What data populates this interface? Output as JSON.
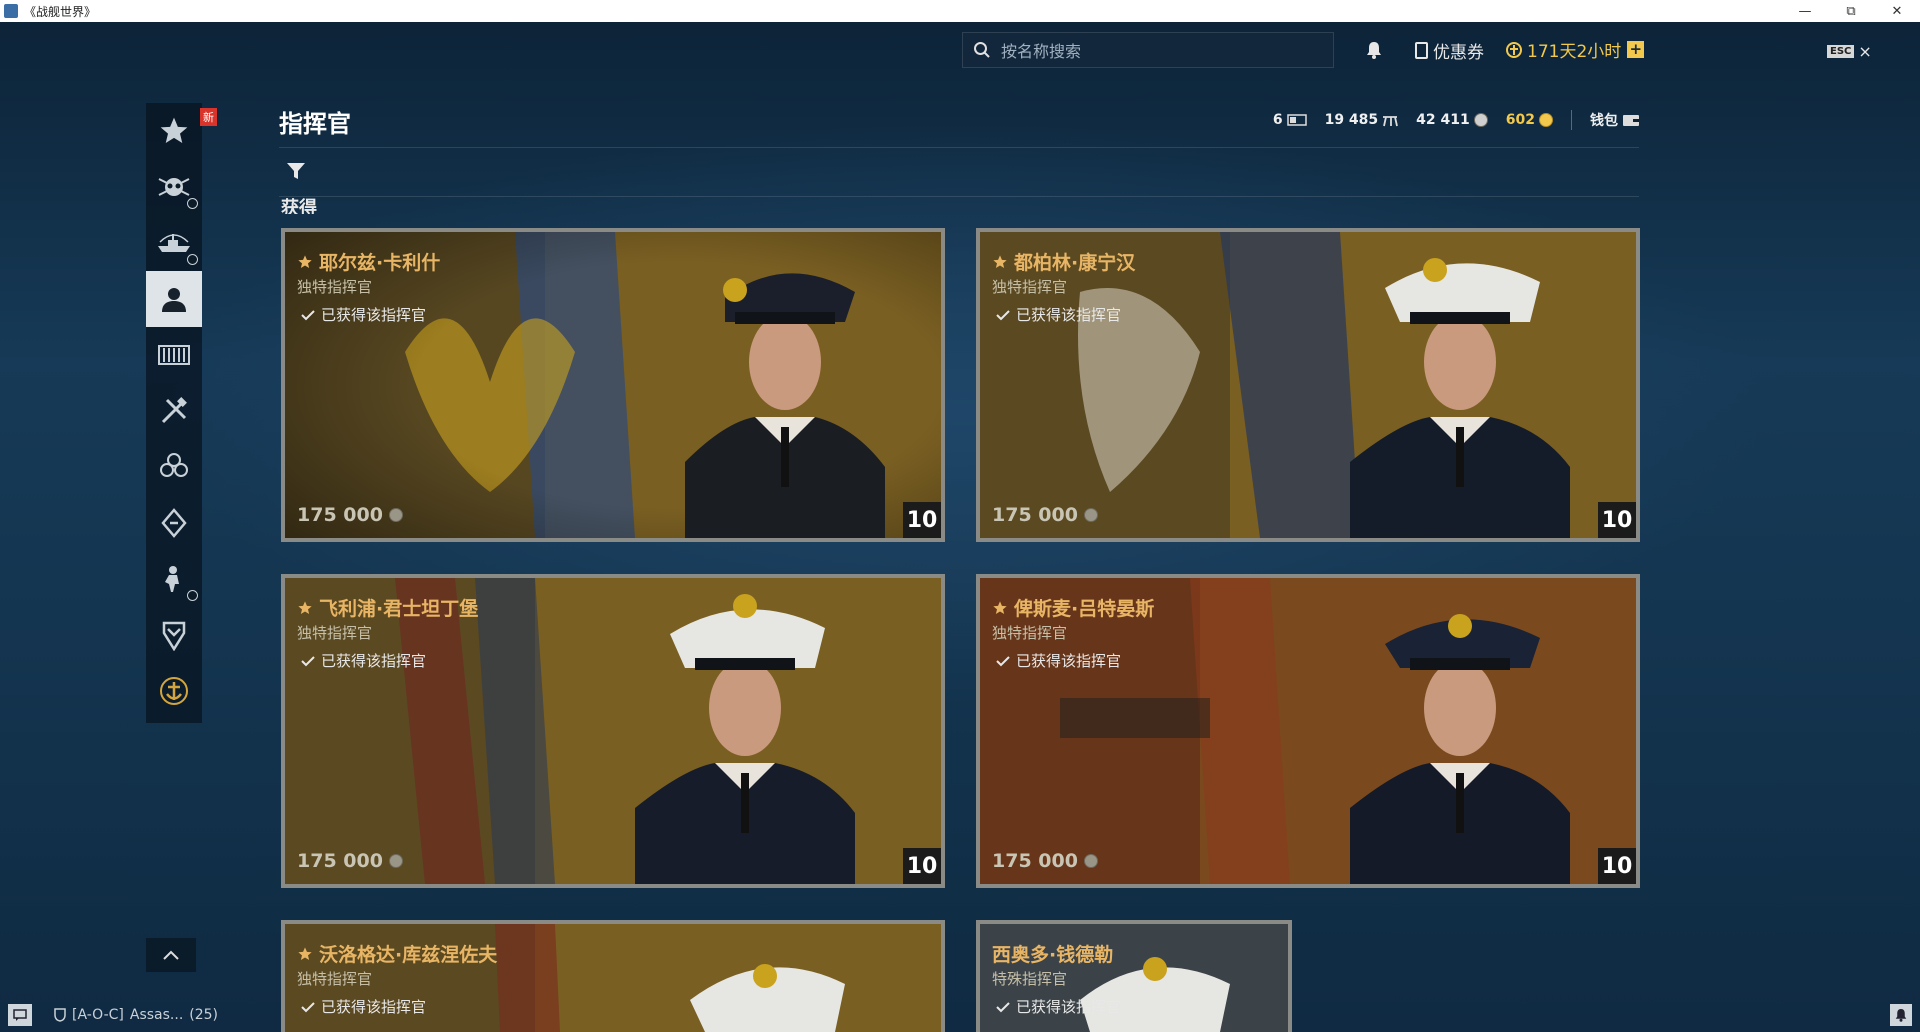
{
  "window": {
    "title": "《战舰世界》"
  },
  "topbar": {
    "search_placeholder": "按名称搜索",
    "coupon_label": "优惠券",
    "premium_time": "171天2小时",
    "premium_add": "+",
    "esc_key": "ESC",
    "close": "×"
  },
  "sidebar": {
    "new_badge": "新",
    "items": [
      {
        "icon": "star-icon"
      },
      {
        "icon": "skull-emblem-icon"
      },
      {
        "icon": "ship-icon"
      },
      {
        "icon": "commander-icon",
        "active": true
      },
      {
        "icon": "armory-icon"
      },
      {
        "icon": "crossed-tools-icon"
      },
      {
        "icon": "clover-icon"
      },
      {
        "icon": "diamond-arrow-icon"
      },
      {
        "icon": "soldier-icon"
      },
      {
        "icon": "rank-shield-icon"
      },
      {
        "icon": "anchor-emblem-icon"
      }
    ]
  },
  "header": {
    "title": "指挥官",
    "resources": {
      "premium_days": "6",
      "free_xp": "19 485",
      "silver": "42 411",
      "gold": "602",
      "wallet": "钱包"
    }
  },
  "section": {
    "title": "获得"
  },
  "cards": [
    {
      "name": "耶尔兹·卡利什",
      "type": "独特指挥官",
      "owned": "已获得该指挥官",
      "price": "175 000",
      "level": "10",
      "starred": true
    },
    {
      "name": "都柏林·康宁汉",
      "type": "独特指挥官",
      "owned": "已获得该指挥官",
      "price": "175 000",
      "level": "10",
      "starred": true
    },
    {
      "name": "飞利浦·君士坦丁堡",
      "type": "独特指挥官",
      "owned": "已获得该指挥官",
      "price": "175 000",
      "level": "10",
      "starred": true
    },
    {
      "name": "俾斯麦·吕特晏斯",
      "type": "独特指挥官",
      "owned": "已获得该指挥官",
      "price": "175 000",
      "level": "10",
      "starred": true
    },
    {
      "name": "沃洛格达·库兹涅佐夫",
      "type": "独特指挥官",
      "owned": "已获得该指挥官",
      "starred": true
    },
    {
      "name": "西奥多·钱德勒",
      "type": "特殊指挥官",
      "owned": "已获得该指挥官",
      "starred": false
    }
  ],
  "statusbar": {
    "clan_tag": "[A-O-C]",
    "player": "Assas...",
    "count": "(25)"
  }
}
